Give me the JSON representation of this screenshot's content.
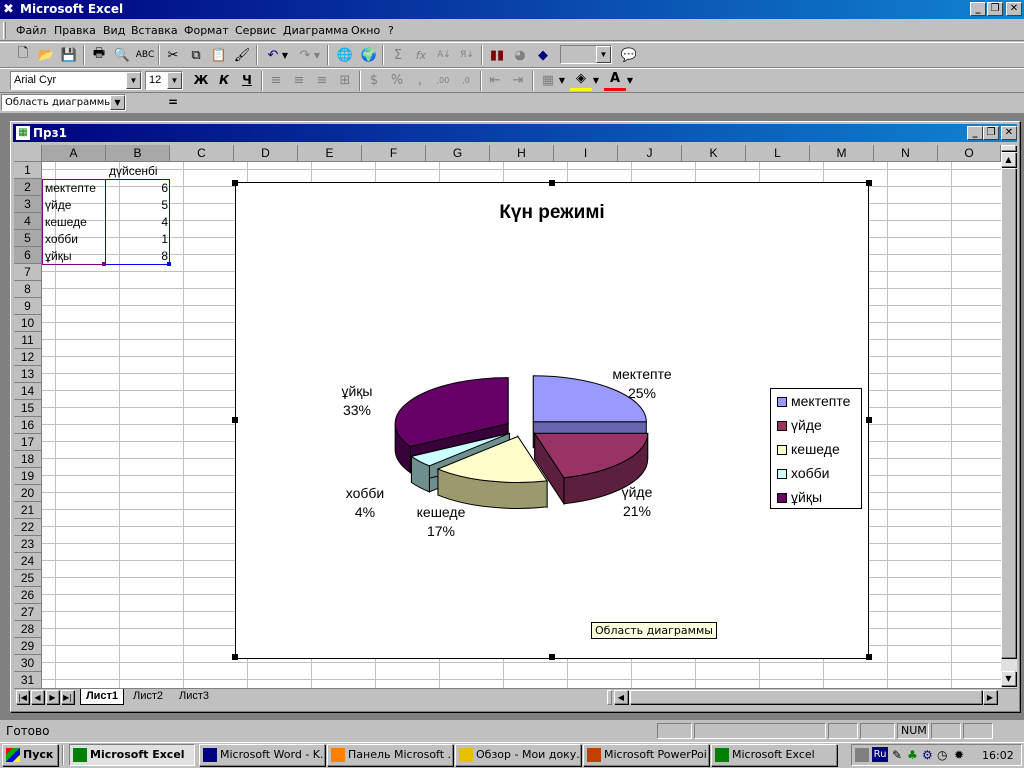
{
  "app": {
    "title": "Microsoft Excel"
  },
  "menu": [
    "Файл",
    "Правка",
    "Вид",
    "Вставка",
    "Формат",
    "Сервис",
    "Диаграмма",
    "Окно",
    "?"
  ],
  "formatting": {
    "font": "Arial Cyr",
    "size": "12"
  },
  "namebox": {
    "value": "Область диаграммы",
    "equals": "="
  },
  "workbook": {
    "title": "Прз1"
  },
  "columns": [
    "A",
    "B",
    "C",
    "D",
    "E",
    "F",
    "G",
    "H",
    "I",
    "J",
    "K",
    "L",
    "M",
    "N",
    "O"
  ],
  "rows": [
    "1",
    "2",
    "3",
    "4",
    "5",
    "6",
    "7",
    "8",
    "9",
    "10",
    "11",
    "12",
    "13",
    "14",
    "15",
    "16",
    "17",
    "18",
    "19",
    "20",
    "21",
    "22",
    "23",
    "24",
    "25",
    "26",
    "27",
    "28",
    "29",
    "30",
    "31"
  ],
  "cells": {
    "B1": "дүйсенбі",
    "A2": "мектепте",
    "B2": "6",
    "A3": "үйде",
    "B3": "5",
    "A4": "кешеде",
    "B4": "4",
    "A5": "хобби",
    "B5": "1",
    "A6": "ұйқы",
    "B6": "8"
  },
  "chart_data": {
    "type": "pie",
    "title": "Күн режимі",
    "categories": [
      "мектепте",
      "үйде",
      "кешеде",
      "хобби",
      "ұйқы"
    ],
    "values": [
      6,
      5,
      4,
      1,
      8
    ],
    "percent_labels": [
      "25%",
      "21%",
      "17%",
      "4%",
      "33%"
    ],
    "colors": [
      "#9999ff",
      "#993366",
      "#ffffcc",
      "#ccffff",
      "#660066"
    ],
    "side_colors": [
      "#6666b0",
      "#5c1f3d",
      "#9a9a6e",
      "#6f8f8f",
      "#3a003a"
    ],
    "legend_position": "right",
    "exploded": true,
    "three_d": true
  },
  "tooltip": "Область диаграммы",
  "sheets": [
    "Лист1",
    "Лист2",
    "Лист3"
  ],
  "active_sheet": "Лист1",
  "status": {
    "text": "Готово",
    "num": "NUM"
  },
  "taskbar": {
    "start": "Пуск",
    "tasks": [
      "Microsoft Excel",
      "Microsoft Word - K...",
      "Панель Microsoft ...",
      "Обзор - Мои доку...",
      "Microsoft PowerPoi...",
      "Microsoft Excel"
    ],
    "clock": "16:02",
    "lang": "Ru"
  }
}
